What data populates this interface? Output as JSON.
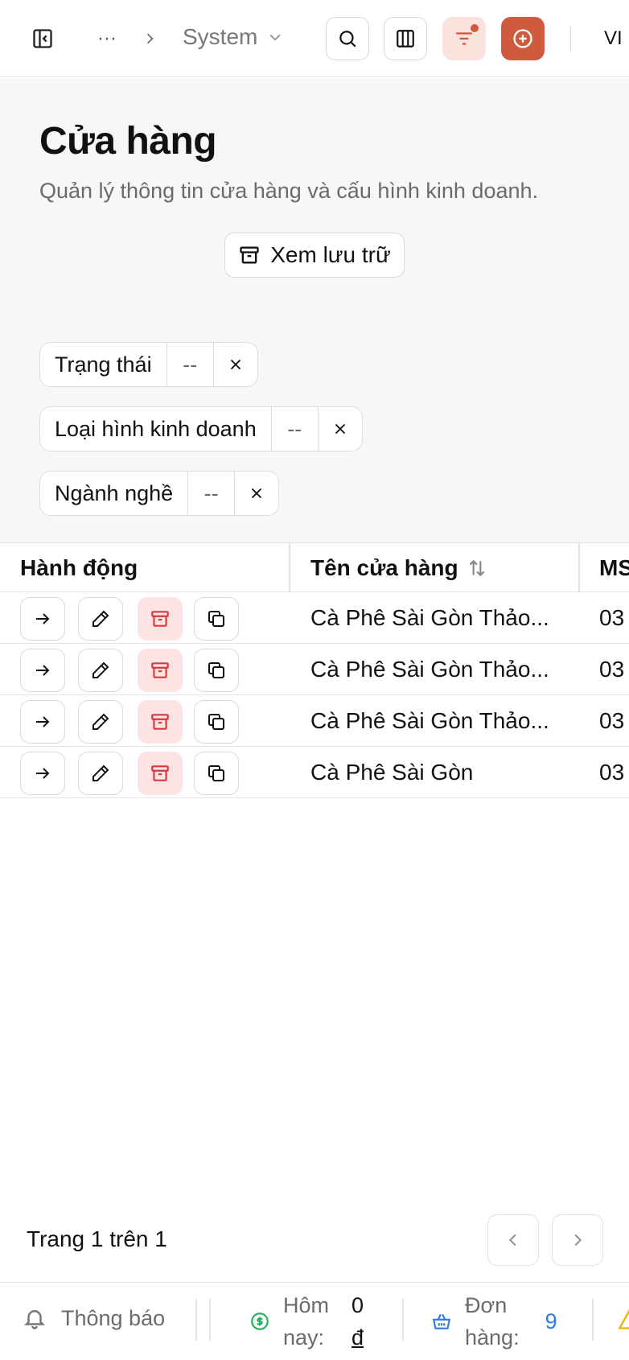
{
  "topbar": {
    "sidebar_toggle_icon": "sidebar-toggle-icon",
    "more_label": "···",
    "breadcrumb_current": "System",
    "lang": "VI"
  },
  "page": {
    "title": "Cửa hàng",
    "subtitle": "Quản lý thông tin cửa hàng và cấu hình kinh doanh.",
    "archive_label": "Xem lưu trữ"
  },
  "filters": [
    {
      "label": "Trạng thái",
      "value": "--"
    },
    {
      "label": "Loại hình kinh doanh",
      "value": "--"
    },
    {
      "label": "Ngành nghề",
      "value": "--"
    }
  ],
  "table": {
    "columns": [
      "Hành động",
      "Tên cửa hàng",
      "MS"
    ],
    "rows": [
      {
        "name": "Cà Phê Sài Gòn Thảo...",
        "ms": "03"
      },
      {
        "name": "Cà Phê Sài Gòn Thảo...",
        "ms": "03"
      },
      {
        "name": "Cà Phê Sài Gòn Thảo...",
        "ms": "03"
      },
      {
        "name": "Cà Phê Sài Gòn",
        "ms": "03"
      }
    ]
  },
  "pagination": {
    "text": "Trang 1 trên 1"
  },
  "bottombar": {
    "notifications": "Thông báo",
    "today_label_1": "Hôm",
    "today_label_2": "nay:",
    "today_value_1": "0",
    "today_value_2": "đ",
    "orders_label_1": "Đơn",
    "orders_label_2": "hàng:",
    "orders_value": "9"
  },
  "colors": {
    "accent": "#cf5a3e",
    "accent_soft": "#fbe3dd",
    "danger": "#d9363e",
    "danger_soft": "#fde4e4",
    "money_green": "#22b35e",
    "link_blue": "#2d7be5",
    "warning": "#f0b400"
  }
}
